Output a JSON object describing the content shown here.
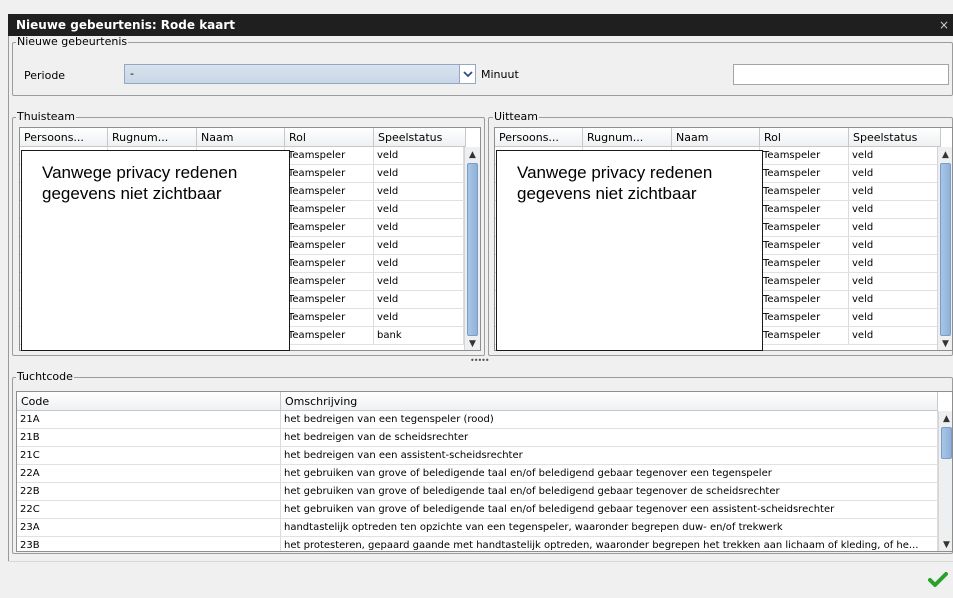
{
  "window": {
    "title": "Nieuwe gebeurtenis: Rode kaart",
    "close_label": "×"
  },
  "event_group": {
    "label": "Nieuwe gebeurtenis",
    "periode_label": "Periode",
    "periode_value": "-",
    "minuut_label": "Minuut",
    "minuut_value": ""
  },
  "home": {
    "label": "Thuisteam",
    "columns": [
      "Persoons...",
      "Rugnum...",
      "Naam",
      "Rol",
      "Speelstatus"
    ],
    "rows": [
      {
        "rol": "Teamspeler",
        "status": "veld"
      },
      {
        "rol": "Teamspeler",
        "status": "veld"
      },
      {
        "rol": "Teamspeler",
        "status": "veld"
      },
      {
        "rol": "Teamspeler",
        "status": "veld"
      },
      {
        "rol": "Teamspeler",
        "status": "veld"
      },
      {
        "rol": "Teamspeler",
        "status": "veld"
      },
      {
        "rol": "Teamspeler",
        "status": "veld"
      },
      {
        "rol": "Teamspeler",
        "status": "veld"
      },
      {
        "rol": "Teamspeler",
        "status": "veld"
      },
      {
        "rol": "Teamspeler",
        "status": "veld"
      },
      {
        "rol": "Teamspeler",
        "status": "bank"
      }
    ],
    "privacy_line1": "Vanwege privacy redenen",
    "privacy_line2": "gegevens niet zichtbaar"
  },
  "away": {
    "label": "Uitteam",
    "columns": [
      "Persoons...",
      "Rugnum...",
      "Naam",
      "Rol",
      "Speelstatus"
    ],
    "rows": [
      {
        "rol": "Teamspeler",
        "status": "veld"
      },
      {
        "rol": "Teamspeler",
        "status": "veld"
      },
      {
        "rol": "Teamspeler",
        "status": "veld"
      },
      {
        "rol": "Teamspeler",
        "status": "veld"
      },
      {
        "rol": "Teamspeler",
        "status": "veld"
      },
      {
        "rol": "Teamspeler",
        "status": "veld"
      },
      {
        "rol": "Teamspeler",
        "status": "veld"
      },
      {
        "rol": "Teamspeler",
        "status": "veld"
      },
      {
        "rol": "Teamspeler",
        "status": "veld"
      },
      {
        "rol": "Teamspeler",
        "status": "veld"
      },
      {
        "rol": "Teamspeler",
        "status": "veld"
      }
    ],
    "privacy_line1": "Vanwege privacy redenen",
    "privacy_line2": "gegevens niet zichtbaar"
  },
  "splitter_dots": "•••••",
  "tucht": {
    "label": "Tuchtcode",
    "columns": [
      "Code",
      "Omschrijving"
    ],
    "rows": [
      {
        "code": "21A",
        "desc": "het bedreigen van een tegenspeler (rood)"
      },
      {
        "code": "21B",
        "desc": "het bedreigen van de scheidsrechter"
      },
      {
        "code": "21C",
        "desc": "het bedreigen van een assistent-scheidsrechter"
      },
      {
        "code": "22A",
        "desc": "het gebruiken van grove of beledigende taal en/of beledigend gebaar tegenover een tegenspeler"
      },
      {
        "code": "22B",
        "desc": "het gebruiken van grove of beledigende taal en/of beledigend gebaar tegenover de scheidsrechter"
      },
      {
        "code": "22C",
        "desc": "het gebruiken van grove of beledigende taal en/of beledigend gebaar tegenover een assistent-scheidsrechter"
      },
      {
        "code": "23A",
        "desc": "handtastelijk optreden ten opzichte van een tegenspeler, waaronder begrepen duw- en/of trekwerk"
      },
      {
        "code": "23B",
        "desc": "het protesteren, gepaard gaande met handtastelijk optreden, waaronder begrepen het trekken aan lichaam of kleding, of he..."
      }
    ]
  },
  "icons": {
    "confirm": "checkmark-icon",
    "dropdown": "chevron-down-icon"
  },
  "colors": {
    "titlebar": "#1f1f1f",
    "confirm": "#2ca02c",
    "combo": "#cfdbe9"
  }
}
